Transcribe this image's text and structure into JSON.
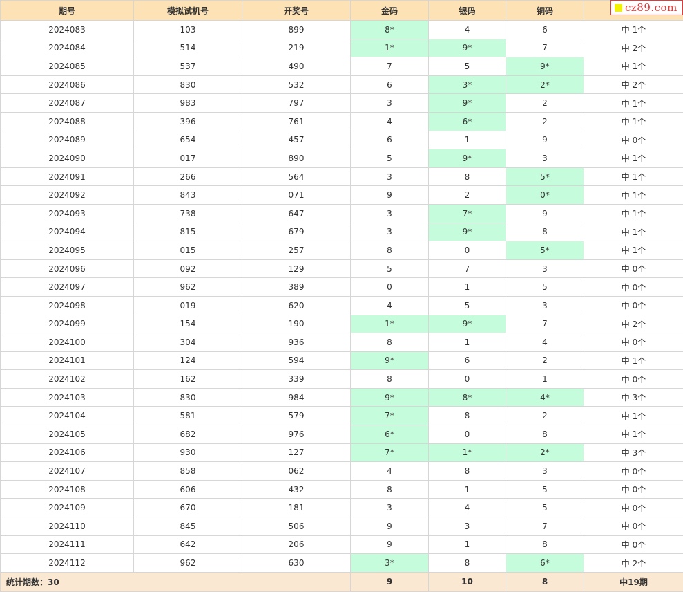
{
  "colors": {
    "header_bg": "#fde2b6",
    "hit_bg": "#c5fcdc",
    "footer_bg": "#fbe8d2",
    "badge_red": "#e03a3a",
    "badge_square": "#f2f200"
  },
  "watermark": "cz89.com",
  "columns": [
    "期号",
    "模拟试机号",
    "开奖号",
    "金码",
    "银码",
    "铜码",
    ""
  ],
  "rows": [
    {
      "issue": "2024083",
      "sim": "103",
      "draw": "899",
      "gold": "8*",
      "silver": "4",
      "bronze": "6",
      "result": "中 1个",
      "gold_hit": true,
      "silver_hit": false,
      "bronze_hit": false
    },
    {
      "issue": "2024084",
      "sim": "514",
      "draw": "219",
      "gold": "1*",
      "silver": "9*",
      "bronze": "7",
      "result": "中 2个",
      "gold_hit": true,
      "silver_hit": true,
      "bronze_hit": false
    },
    {
      "issue": "2024085",
      "sim": "537",
      "draw": "490",
      "gold": "7",
      "silver": "5",
      "bronze": "9*",
      "result": "中 1个",
      "gold_hit": false,
      "silver_hit": false,
      "bronze_hit": true
    },
    {
      "issue": "2024086",
      "sim": "830",
      "draw": "532",
      "gold": "6",
      "silver": "3*",
      "bronze": "2*",
      "result": "中 2个",
      "gold_hit": false,
      "silver_hit": true,
      "bronze_hit": true
    },
    {
      "issue": "2024087",
      "sim": "983",
      "draw": "797",
      "gold": "3",
      "silver": "9*",
      "bronze": "2",
      "result": "中 1个",
      "gold_hit": false,
      "silver_hit": true,
      "bronze_hit": false
    },
    {
      "issue": "2024088",
      "sim": "396",
      "draw": "761",
      "gold": "4",
      "silver": "6*",
      "bronze": "2",
      "result": "中 1个",
      "gold_hit": false,
      "silver_hit": true,
      "bronze_hit": false
    },
    {
      "issue": "2024089",
      "sim": "654",
      "draw": "457",
      "gold": "6",
      "silver": "1",
      "bronze": "9",
      "result": "中 0个",
      "gold_hit": false,
      "silver_hit": false,
      "bronze_hit": false
    },
    {
      "issue": "2024090",
      "sim": "017",
      "draw": "890",
      "gold": "5",
      "silver": "9*",
      "bronze": "3",
      "result": "中 1个",
      "gold_hit": false,
      "silver_hit": true,
      "bronze_hit": false
    },
    {
      "issue": "2024091",
      "sim": "266",
      "draw": "564",
      "gold": "3",
      "silver": "8",
      "bronze": "5*",
      "result": "中 1个",
      "gold_hit": false,
      "silver_hit": false,
      "bronze_hit": true
    },
    {
      "issue": "2024092",
      "sim": "843",
      "draw": "071",
      "gold": "9",
      "silver": "2",
      "bronze": "0*",
      "result": "中 1个",
      "gold_hit": false,
      "silver_hit": false,
      "bronze_hit": true
    },
    {
      "issue": "2024093",
      "sim": "738",
      "draw": "647",
      "gold": "3",
      "silver": "7*",
      "bronze": "9",
      "result": "中 1个",
      "gold_hit": false,
      "silver_hit": true,
      "bronze_hit": false
    },
    {
      "issue": "2024094",
      "sim": "815",
      "draw": "679",
      "gold": "3",
      "silver": "9*",
      "bronze": "8",
      "result": "中 1个",
      "gold_hit": false,
      "silver_hit": true,
      "bronze_hit": false
    },
    {
      "issue": "2024095",
      "sim": "015",
      "draw": "257",
      "gold": "8",
      "silver": "0",
      "bronze": "5*",
      "result": "中 1个",
      "gold_hit": false,
      "silver_hit": false,
      "bronze_hit": true
    },
    {
      "issue": "2024096",
      "sim": "092",
      "draw": "129",
      "gold": "5",
      "silver": "7",
      "bronze": "3",
      "result": "中 0个",
      "gold_hit": false,
      "silver_hit": false,
      "bronze_hit": false
    },
    {
      "issue": "2024097",
      "sim": "962",
      "draw": "389",
      "gold": "0",
      "silver": "1",
      "bronze": "5",
      "result": "中 0个",
      "gold_hit": false,
      "silver_hit": false,
      "bronze_hit": false
    },
    {
      "issue": "2024098",
      "sim": "019",
      "draw": "620",
      "gold": "4",
      "silver": "5",
      "bronze": "3",
      "result": "中 0个",
      "gold_hit": false,
      "silver_hit": false,
      "bronze_hit": false
    },
    {
      "issue": "2024099",
      "sim": "154",
      "draw": "190",
      "gold": "1*",
      "silver": "9*",
      "bronze": "7",
      "result": "中 2个",
      "gold_hit": true,
      "silver_hit": true,
      "bronze_hit": false
    },
    {
      "issue": "2024100",
      "sim": "304",
      "draw": "936",
      "gold": "8",
      "silver": "1",
      "bronze": "4",
      "result": "中 0个",
      "gold_hit": false,
      "silver_hit": false,
      "bronze_hit": false
    },
    {
      "issue": "2024101",
      "sim": "124",
      "draw": "594",
      "gold": "9*",
      "silver": "6",
      "bronze": "2",
      "result": "中 1个",
      "gold_hit": true,
      "silver_hit": false,
      "bronze_hit": false
    },
    {
      "issue": "2024102",
      "sim": "162",
      "draw": "339",
      "gold": "8",
      "silver": "0",
      "bronze": "1",
      "result": "中 0个",
      "gold_hit": false,
      "silver_hit": false,
      "bronze_hit": false
    },
    {
      "issue": "2024103",
      "sim": "830",
      "draw": "984",
      "gold": "9*",
      "silver": "8*",
      "bronze": "4*",
      "result": "中 3个",
      "gold_hit": true,
      "silver_hit": true,
      "bronze_hit": true
    },
    {
      "issue": "2024104",
      "sim": "581",
      "draw": "579",
      "gold": "7*",
      "silver": "8",
      "bronze": "2",
      "result": "中 1个",
      "gold_hit": true,
      "silver_hit": false,
      "bronze_hit": false
    },
    {
      "issue": "2024105",
      "sim": "682",
      "draw": "976",
      "gold": "6*",
      "silver": "0",
      "bronze": "8",
      "result": "中 1个",
      "gold_hit": true,
      "silver_hit": false,
      "bronze_hit": false
    },
    {
      "issue": "2024106",
      "sim": "930",
      "draw": "127",
      "gold": "7*",
      "silver": "1*",
      "bronze": "2*",
      "result": "中 3个",
      "gold_hit": true,
      "silver_hit": true,
      "bronze_hit": true
    },
    {
      "issue": "2024107",
      "sim": "858",
      "draw": "062",
      "gold": "4",
      "silver": "8",
      "bronze": "3",
      "result": "中 0个",
      "gold_hit": false,
      "silver_hit": false,
      "bronze_hit": false
    },
    {
      "issue": "2024108",
      "sim": "606",
      "draw": "432",
      "gold": "8",
      "silver": "1",
      "bronze": "5",
      "result": "中 0个",
      "gold_hit": false,
      "silver_hit": false,
      "bronze_hit": false
    },
    {
      "issue": "2024109",
      "sim": "670",
      "draw": "181",
      "gold": "3",
      "silver": "4",
      "bronze": "5",
      "result": "中 0个",
      "gold_hit": false,
      "silver_hit": false,
      "bronze_hit": false
    },
    {
      "issue": "2024110",
      "sim": "845",
      "draw": "506",
      "gold": "9",
      "silver": "3",
      "bronze": "7",
      "result": "中 0个",
      "gold_hit": false,
      "silver_hit": false,
      "bronze_hit": false
    },
    {
      "issue": "2024111",
      "sim": "642",
      "draw": "206",
      "gold": "9",
      "silver": "1",
      "bronze": "8",
      "result": "中 0个",
      "gold_hit": false,
      "silver_hit": false,
      "bronze_hit": false
    },
    {
      "issue": "2024112",
      "sim": "962",
      "draw": "630",
      "gold": "3*",
      "silver": "8",
      "bronze": "6*",
      "result": "中 2个",
      "gold_hit": true,
      "silver_hit": false,
      "bronze_hit": true
    }
  ],
  "footer": {
    "label": "统计期数：30",
    "gold": "9",
    "silver": "10",
    "bronze": "8",
    "result": "中19期"
  }
}
